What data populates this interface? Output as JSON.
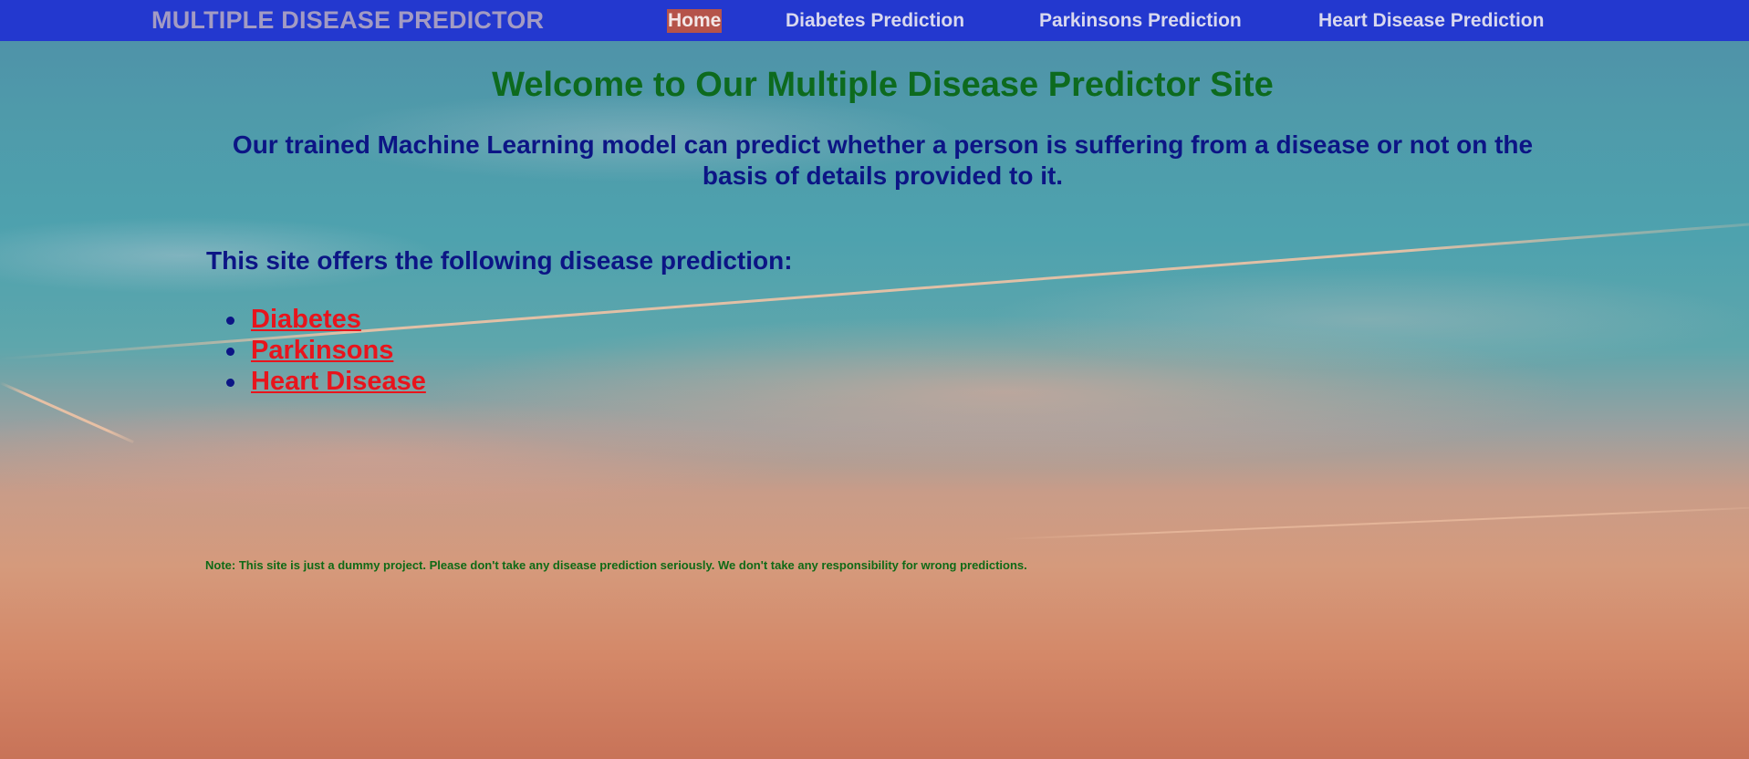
{
  "navbar": {
    "brand": "MULTIPLE DISEASE PREDICTOR",
    "links": [
      {
        "label": "Home",
        "active": true
      },
      {
        "label": "Diabetes Prediction",
        "active": false
      },
      {
        "label": "Parkinsons Prediction",
        "active": false
      },
      {
        "label": "Heart Disease Prediction",
        "active": false
      }
    ]
  },
  "main": {
    "welcome": "Welcome to Our Multiple Disease Predictor Site",
    "intro": "Our trained Machine Learning model can predict whether a person is suffering from a disease or not on the basis of details provided to it.",
    "offers_heading": "This site offers the following disease prediction:",
    "diseases": [
      "Diabetes",
      "Parkinsons",
      "Heart Disease"
    ],
    "note": "Note: This site is just a dummy project. Please don't take any disease prediction seriously. We don't take any responsibility for wrong predictions."
  },
  "colors": {
    "navbar_bg": "#2338cf",
    "brand_text": "#a39bc3",
    "active_link_bg": "#b5534a",
    "welcome_text": "#0d6a1e",
    "body_text": "#0c1585",
    "disease_link": "#e8141c",
    "note_text": "#0f6a16"
  }
}
